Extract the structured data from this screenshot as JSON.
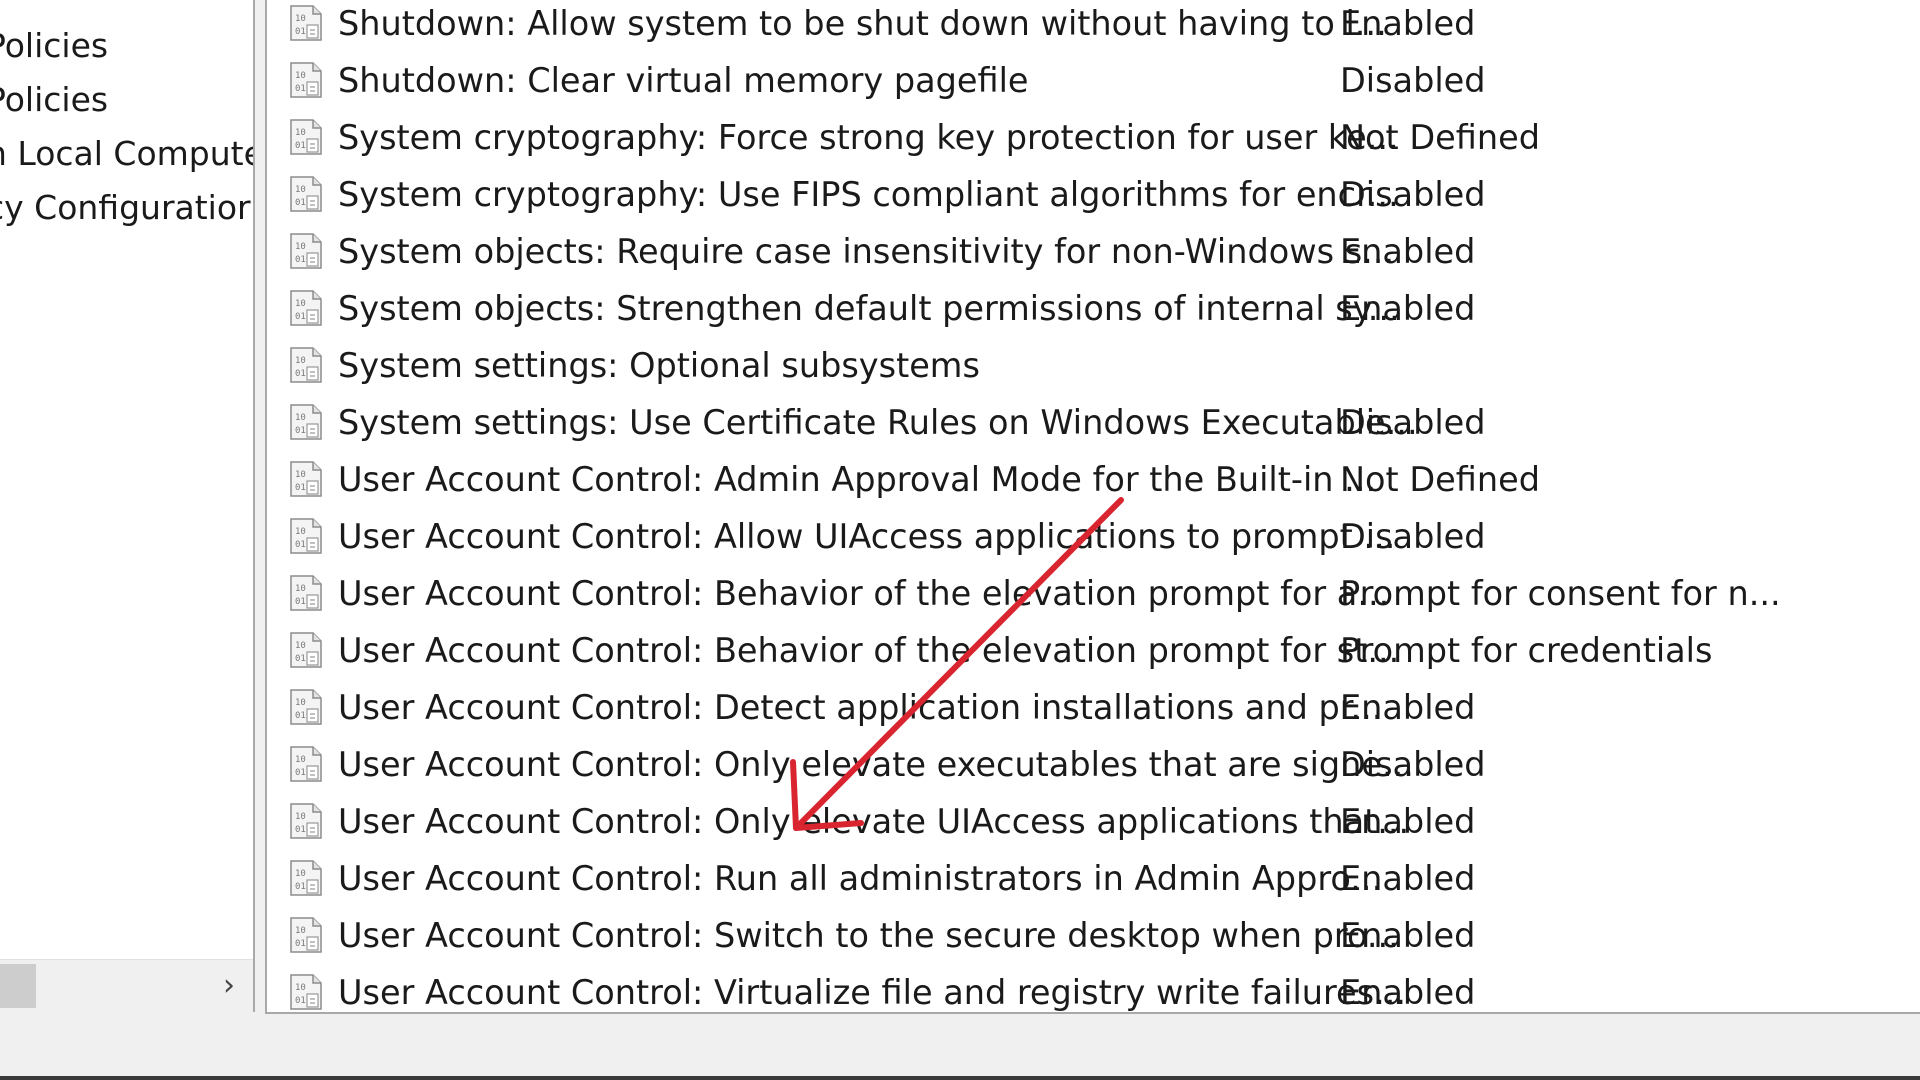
{
  "tree": {
    "items": [
      {
        "label": "Policies"
      },
      {
        "label": "Policies"
      },
      {
        "label": "n Local Compute"
      },
      {
        "label": "cy Configuratior"
      }
    ],
    "scroll_right_glyph": "›"
  },
  "policies": {
    "icon": "policy-document-icon",
    "rows": [
      {
        "policy": "Shutdown: Allow system to be shut down without having to l...",
        "setting": "Enabled"
      },
      {
        "policy": "Shutdown: Clear virtual memory pagefile",
        "setting": "Disabled"
      },
      {
        "policy": "System cryptography: Force strong key protection for user ke...",
        "setting": "Not Defined"
      },
      {
        "policy": "System cryptography: Use FIPS compliant algorithms for encr...",
        "setting": "Disabled"
      },
      {
        "policy": "System objects: Require case insensitivity for non-Windows s...",
        "setting": "Enabled"
      },
      {
        "policy": "System objects: Strengthen default permissions of internal sy...",
        "setting": "Enabled"
      },
      {
        "policy": "System settings: Optional subsystems",
        "setting": ""
      },
      {
        "policy": "System settings: Use Certificate Rules on Windows Executable...",
        "setting": "Disabled"
      },
      {
        "policy": "User Account Control: Admin Approval Mode for the Built-in ...",
        "setting": "Not Defined"
      },
      {
        "policy": "User Account Control: Allow UIAccess applications to prompt ...",
        "setting": "Disabled"
      },
      {
        "policy": "User Account Control: Behavior of the elevation prompt for a...",
        "setting": "Prompt for consent for n..."
      },
      {
        "policy": "User Account Control: Behavior of the elevation prompt for st...",
        "setting": "Prompt for credentials"
      },
      {
        "policy": "User Account Control: Detect application installations and pr...",
        "setting": "Enabled"
      },
      {
        "policy": "User Account Control: Only elevate executables that are signe...",
        "setting": "Disabled"
      },
      {
        "policy": "User Account Control: Only elevate UIAccess applications that...",
        "setting": "Enabled"
      },
      {
        "policy": "User Account Control: Run all administrators in Admin Appro...",
        "setting": "Enabled"
      },
      {
        "policy": "User Account Control: Switch to the secure desktop when pro...",
        "setting": "Enabled"
      },
      {
        "policy": "User Account Control: Virtualize file and registry write failures...",
        "setting": "Enabled"
      }
    ]
  },
  "annotation": {
    "arrow_color": "#d9252f"
  }
}
